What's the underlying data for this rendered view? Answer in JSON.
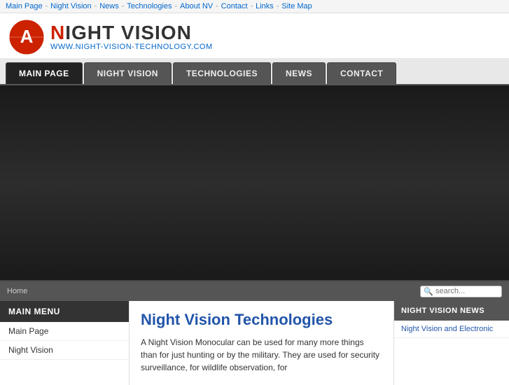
{
  "topnav": {
    "items": [
      {
        "label": "Main Page",
        "href": "#"
      },
      {
        "label": "Night Vision",
        "href": "#"
      },
      {
        "label": "News",
        "href": "#"
      },
      {
        "label": "Technologies",
        "href": "#"
      },
      {
        "label": "About NV",
        "href": "#"
      },
      {
        "label": "Contact",
        "href": "#"
      },
      {
        "label": "Links",
        "href": "#"
      },
      {
        "label": "Site Map",
        "href": "#"
      }
    ]
  },
  "header": {
    "logo_main": "HT VISION",
    "logo_prefix": "A",
    "logo_subtitle": "WWW.NIGHT-VISION-TECHNOLOGY.COM"
  },
  "tabs": [
    {
      "label": "MAIN PAGE",
      "active": true
    },
    {
      "label": "NIGHT VISION",
      "active": false
    },
    {
      "label": "TECHNOLOGIES",
      "active": false
    },
    {
      "label": "NEWS",
      "active": false
    },
    {
      "label": "CONTACT",
      "active": false
    }
  ],
  "breadcrumb": {
    "home": "Home"
  },
  "search": {
    "placeholder": "search..."
  },
  "sidebar_left": {
    "menu_header": "MAIN MENU",
    "items": [
      {
        "label": "Main Page"
      },
      {
        "label": "Night Vision"
      }
    ]
  },
  "main_content": {
    "title": "Night Vision Technologies",
    "body": "A Night Vision Monocular can be used for many more things than for just hunting or by the military. They are used for security surveillance, for wildlife observation, for"
  },
  "sidebar_right": {
    "header": "NIGHT VISION NEWS",
    "items": [
      {
        "label": "Night Vision and Electronic"
      }
    ]
  }
}
